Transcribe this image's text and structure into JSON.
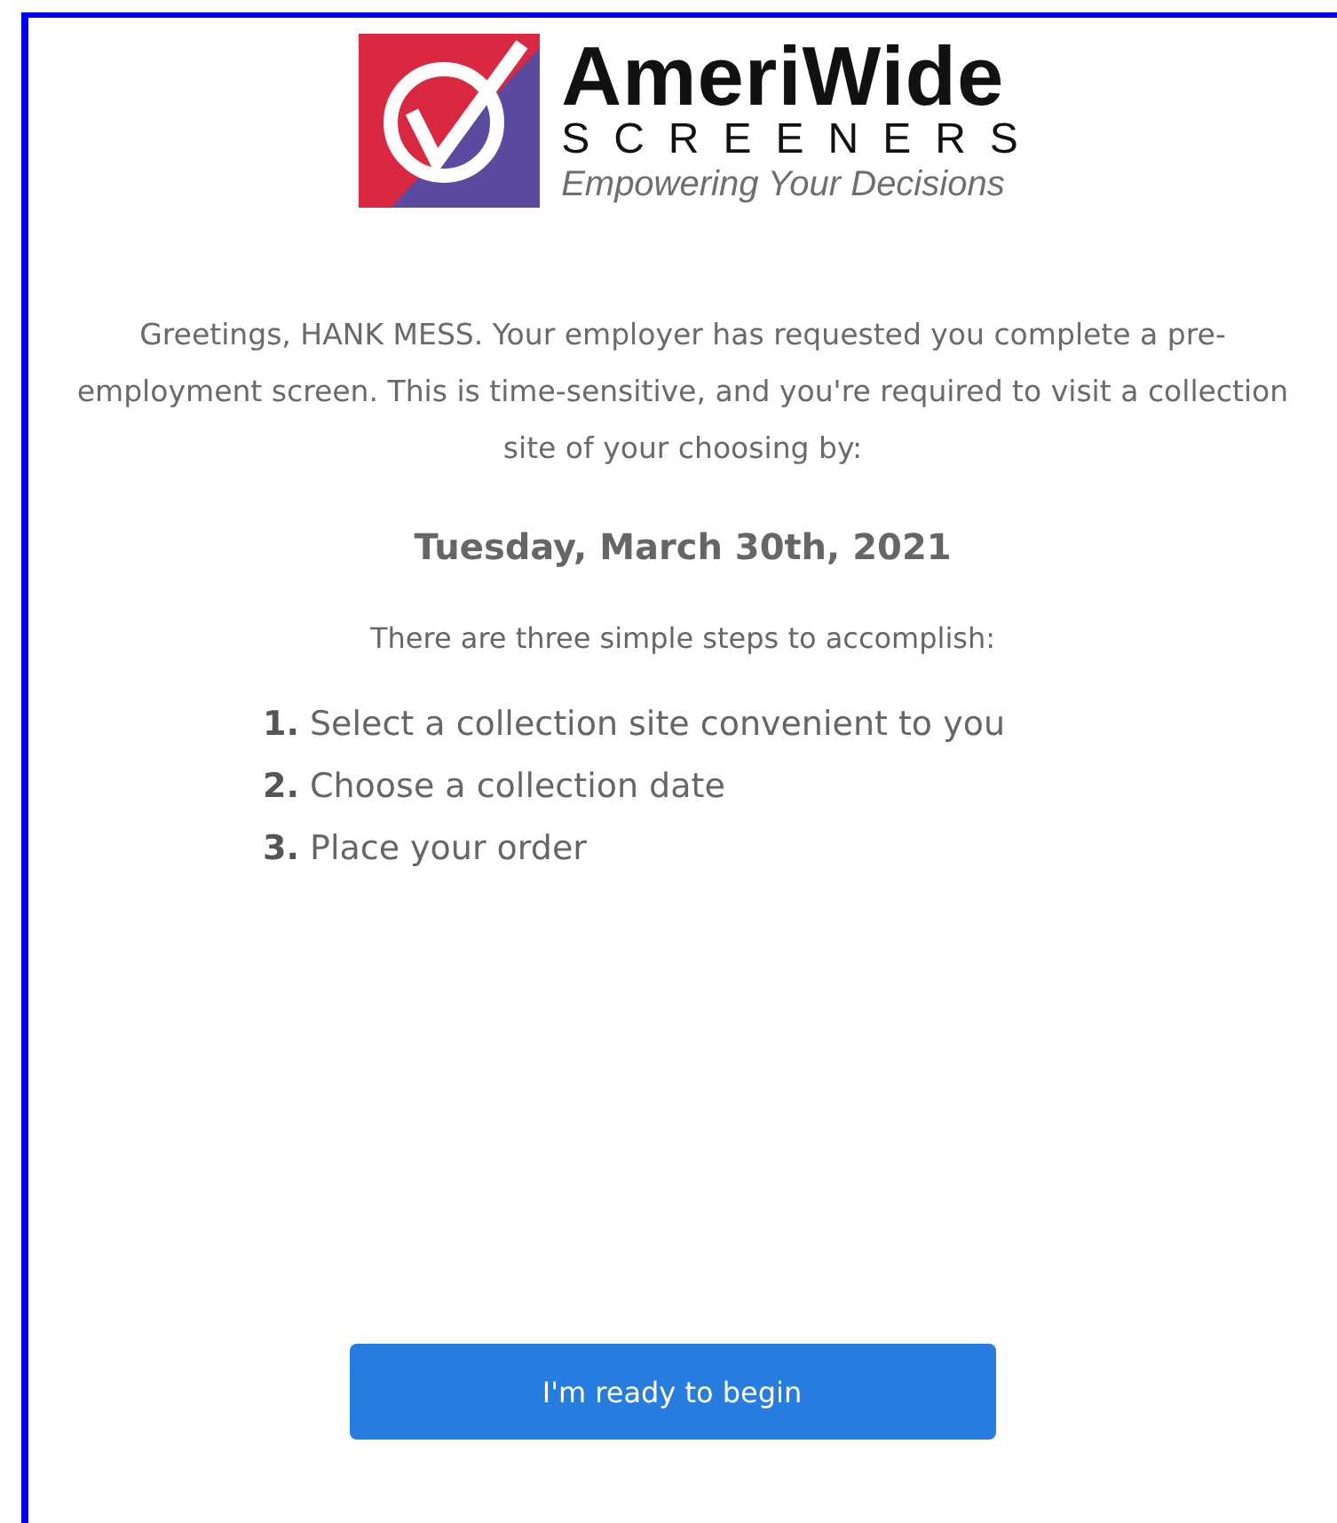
{
  "logo": {
    "name": "AmeriWide",
    "subtitle": "SCREENERS",
    "tagline": "Empowering Your Decisions"
  },
  "greeting": "Greetings, HANK MESS. Your employer has requested you complete a pre-employment screen. This is time-sensitive, and you're required to visit a collection site of your choosing by:",
  "deadline": "Tuesday, March 30th, 2021",
  "intro": "There are three simple steps to accomplish:",
  "steps": [
    "**1.** Select a collection site convenient to you",
    "**2.** Choose a collection date",
    "**3.** Place your order"
  ],
  "button": {
    "label": "I'm ready to begin"
  }
}
